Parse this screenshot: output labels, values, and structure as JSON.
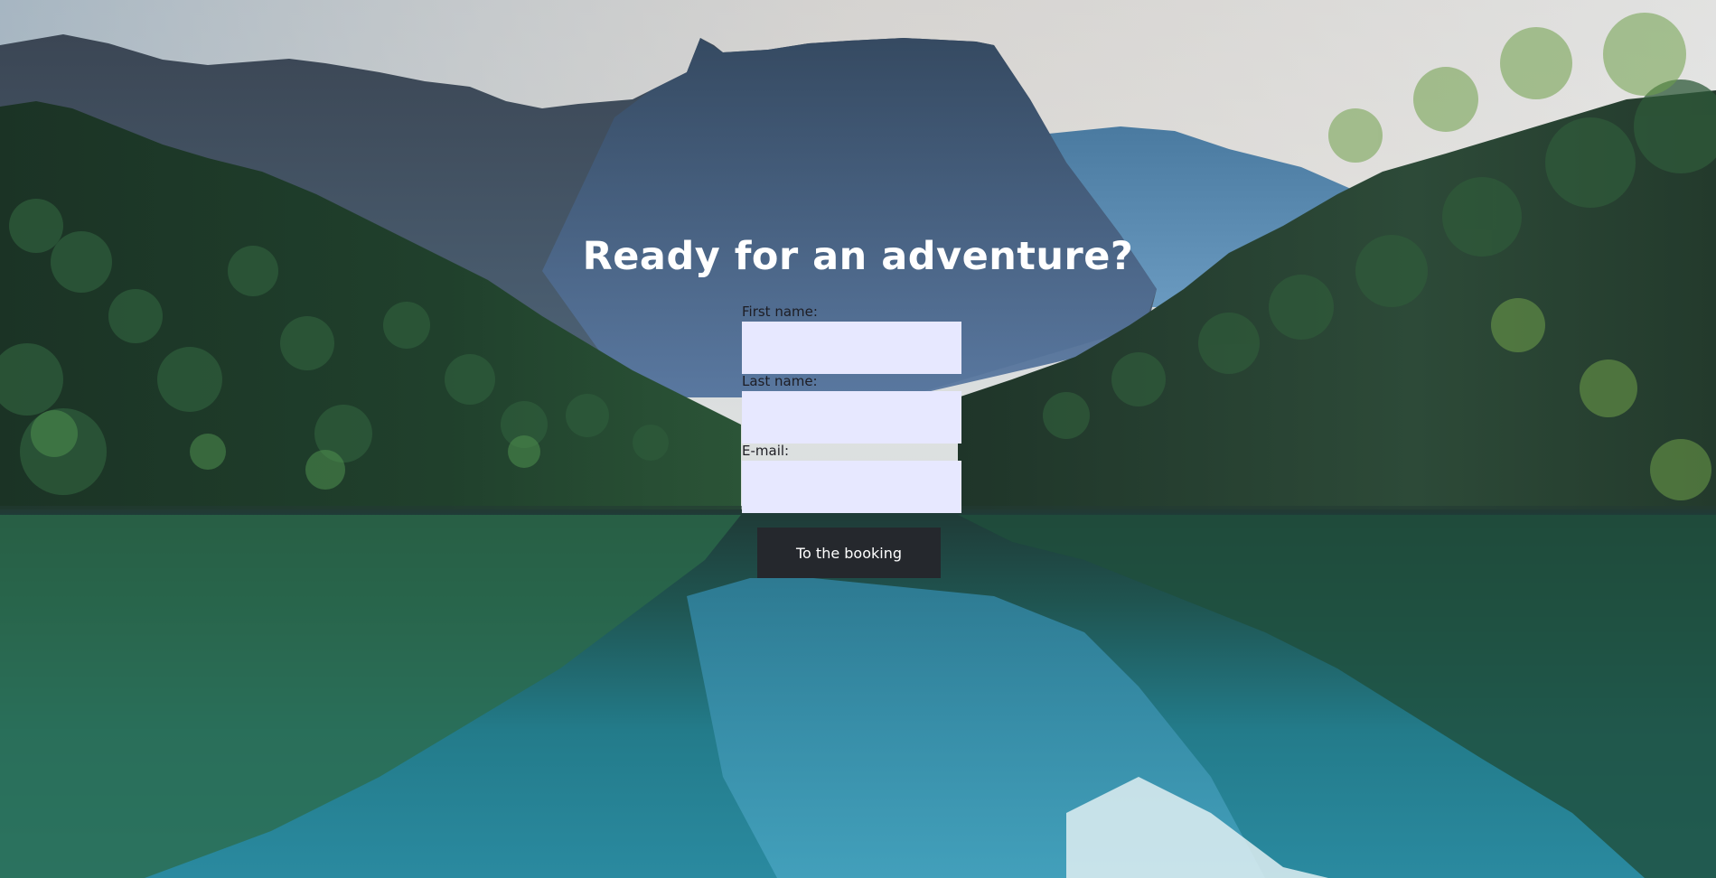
{
  "hero": {
    "title": "Ready for an adventure?"
  },
  "form": {
    "fields": [
      {
        "label": "First name:",
        "value": ""
      },
      {
        "label": "Last name:",
        "value": ""
      },
      {
        "label": "E-mail:",
        "value": ""
      }
    ],
    "submit_label": "To the booking"
  },
  "colors": {
    "input_background": "#e7e8ff",
    "button_background": "#25282d",
    "title_text": "#ffffff",
    "label_text": "#1d1d24"
  }
}
